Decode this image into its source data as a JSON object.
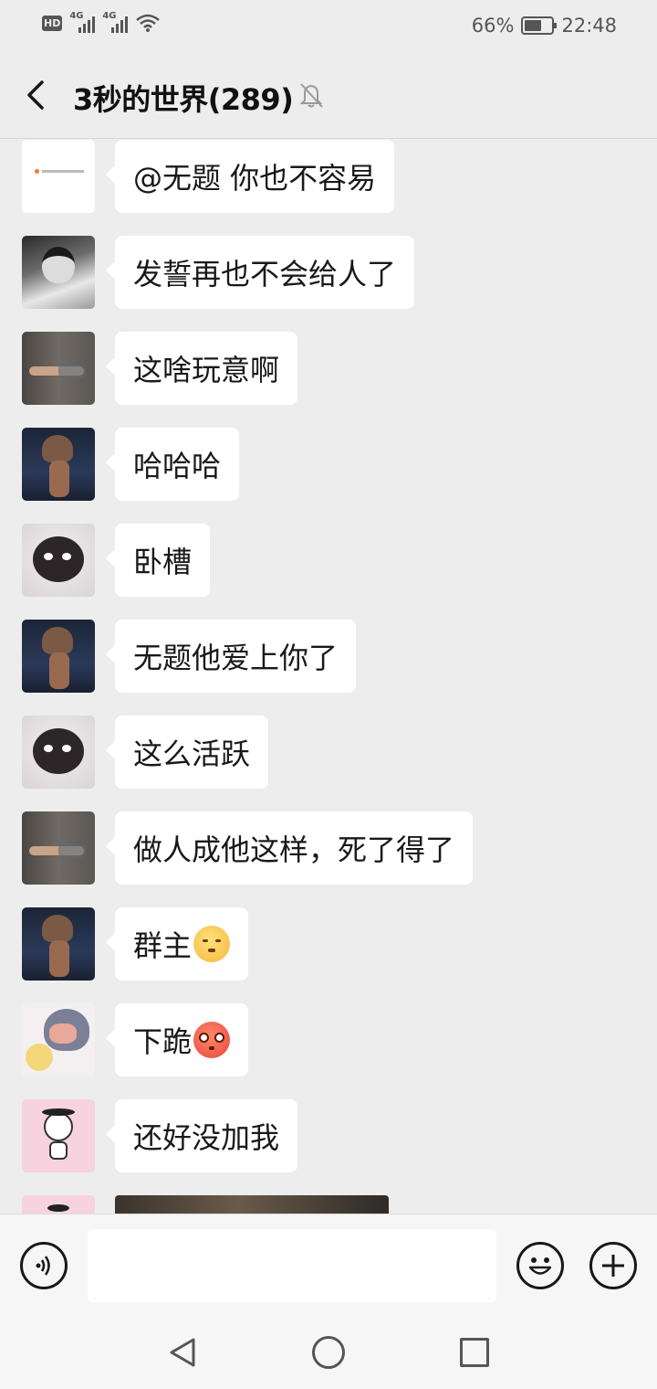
{
  "status": {
    "hd_label": "HD",
    "signal1_label": "4G",
    "signal2_label": "4G",
    "battery_percent": "66%",
    "battery_level": 0.66,
    "time": "22:48"
  },
  "header": {
    "back_icon": "chevron-left-icon",
    "title": "3秒的世界(289)",
    "mute_icon": "bell-off-icon"
  },
  "messages": [
    {
      "avatar": "avatar-note-card",
      "text": "@无题  你也不容易"
    },
    {
      "avatar": "avatar-anime-boy",
      "text": "发誓再也不会给人了"
    },
    {
      "avatar": "avatar-tattoo-hand",
      "text": "这啥玩意啊"
    },
    {
      "avatar": "avatar-hooded-figure",
      "text": "哈哈哈"
    },
    {
      "avatar": "avatar-soot-sprite",
      "text": "卧槽"
    },
    {
      "avatar": "avatar-hooded-figure",
      "text": "无题他爱上你了"
    },
    {
      "avatar": "avatar-soot-sprite",
      "text": "这么活跃"
    },
    {
      "avatar": "avatar-tattoo-hand",
      "text": "做人成他这样，死了得了"
    },
    {
      "avatar": "avatar-hooded-figure",
      "text": "群主",
      "emoji": "shy-face-emoji"
    },
    {
      "avatar": "avatar-anime-girl",
      "text": "下跪",
      "emoji": "flushed-face-emoji"
    },
    {
      "avatar": "avatar-cartoon-kid",
      "text": "还好没加我"
    },
    {
      "avatar": "avatar-cartoon-kid",
      "image": "photo-message"
    }
  ],
  "input": {
    "voice_icon": "voice-icon",
    "text_value": "",
    "emoji_icon": "emoji-icon",
    "plus_icon": "plus-icon"
  },
  "navbar": {
    "back_icon": "nav-back-icon",
    "home_icon": "nav-home-icon",
    "recent_icon": "nav-recent-icon"
  }
}
